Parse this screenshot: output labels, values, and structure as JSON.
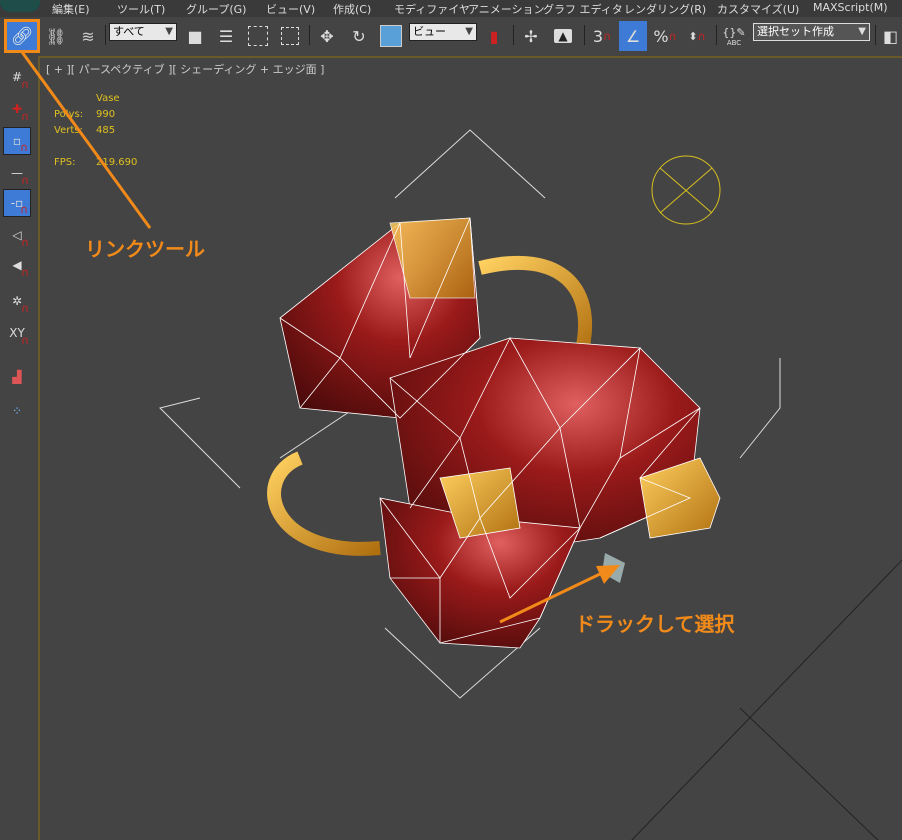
{
  "menubar": {
    "items": [
      "編集(E)",
      "ツール(T)",
      "グループ(G)",
      "ビュー(V)",
      "作成(C)",
      "モディファイヤ",
      "アニメーション",
      "グラフ エディタ",
      "レンダリング(R)",
      "カスタマイズ(U)",
      "MAXScript(M)"
    ]
  },
  "toolbar": {
    "selection_filter": "すべて",
    "reference_coord": "ビュー",
    "angle_snap_value": "3",
    "percent_label": "%",
    "named_selection": "選択セット作成",
    "abc_label": "ABC"
  },
  "leftbar": {
    "xy_label": "XY"
  },
  "viewport": {
    "label": "[ + ][ パースペクティブ ][ シェーディング + エッジ面 ]",
    "object_name": "Vase",
    "polys_label": "Polys:",
    "polys_value": "990",
    "verts_label": "Verts:",
    "verts_value": "485",
    "fps_label": "FPS:",
    "fps_value": "219.690"
  },
  "annotations": {
    "link_tool": "リンクツール",
    "drag_select": "ドラックして選択"
  },
  "colors": {
    "accent": "#3d7bd6",
    "annotation": "#f28a1a",
    "stats": "#e0c020"
  }
}
